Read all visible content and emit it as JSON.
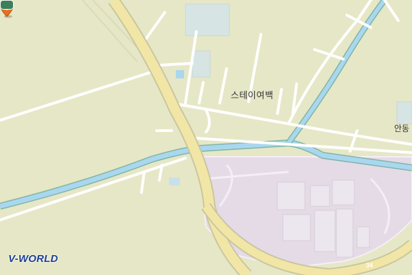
{
  "map": {
    "poi_label": "스테이여백",
    "place_label": "안동",
    "logo_text": "V-WORLD",
    "route_number": "34",
    "colors": {
      "land": "#e6e7c6",
      "facility": "#e4dbe6",
      "road": "#ffffff",
      "highway": "#f2e6a6",
      "water": "#a9d7ef",
      "water_edge": "#7fb5a5",
      "building": "#ece7ee",
      "poi": "#f5a11a",
      "marker": "#e8711e"
    },
    "icons": {
      "poi": "lodging-icon",
      "marker": "location-pin-icon",
      "route": "route-shield-icon"
    }
  }
}
